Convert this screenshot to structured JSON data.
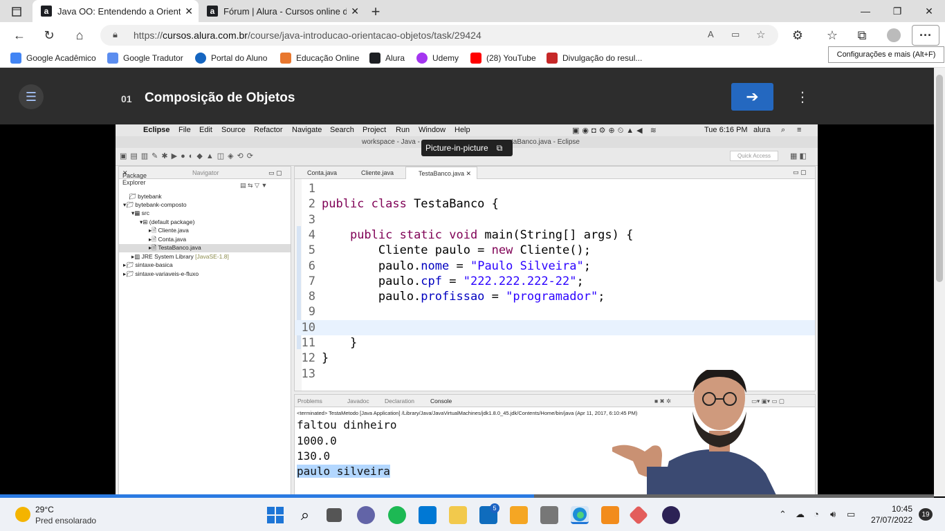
{
  "browser": {
    "tabs": [
      {
        "favicon": "a",
        "title": "Java OO: Entendendo a Orientaç",
        "active": true
      },
      {
        "favicon": "a",
        "title": "Fórum | Alura - Cursos online de",
        "active": false
      }
    ],
    "new_tab": "+",
    "url_scheme": "https://",
    "url_host": "cursos.alura.com.br",
    "url_path": "/course/java-introducao-orientacao-objetos/task/29424",
    "bookmarks": [
      {
        "label": "Google Acadêmico",
        "color": "#4285f4"
      },
      {
        "label": "Google Tradutor",
        "color": "#5b8def"
      },
      {
        "label": "Portal do Aluno",
        "color": "#1565c0"
      },
      {
        "label": "Educação Online",
        "color": "#e8772e"
      },
      {
        "label": "Alura",
        "color": "#1d1f23"
      },
      {
        "label": "Udemy",
        "color": "#a435f0"
      },
      {
        "label": "(28) YouTube",
        "color": "#ff0000"
      },
      {
        "label": "Divulgação do resul...",
        "color": "#c62828"
      }
    ],
    "tooltip": "Configurações e mais (Alt+F)"
  },
  "lesson": {
    "number": "01",
    "title": "Composição de Objetos"
  },
  "mac": {
    "menu": [
      "Eclipse",
      "File",
      "Edit",
      "Source",
      "Refactor",
      "Navigate",
      "Search",
      "Project",
      "Run",
      "Window",
      "Help"
    ],
    "time": "Tue 6:16 PM",
    "user": "alura",
    "window_title_left": "workspace - Java -",
    "window_title_right": "taBanco.java - Eclipse",
    "pip_label": "Picture-in-picture",
    "quick_access": "Quick Access"
  },
  "package_explorer": {
    "tab_label": "Package Explorer",
    "navigator_label": "Navigator",
    "items": [
      "bytebank",
      "bytebank-composto",
      "src",
      "(default package)",
      "Cliente.java",
      "Conta.java",
      "TestaBanco.java",
      "JRE System Library",
      "sintaxe-basica",
      "sintaxe-variaveis-e-fluxo"
    ],
    "jre_version": "[JavaSE-1.8]"
  },
  "editor": {
    "tabs": [
      "Conta.java",
      "Cliente.java",
      "TestaBanco.java"
    ],
    "lines": [
      {
        "n": "1",
        "segs": []
      },
      {
        "n": "2",
        "segs": [
          {
            "c": "kw",
            "t": "public class"
          },
          {
            "c": "",
            "t": " TestaBanco {"
          }
        ]
      },
      {
        "n": "3",
        "segs": []
      },
      {
        "n": "4",
        "segs": [
          {
            "c": "",
            "t": "    "
          },
          {
            "c": "kw",
            "t": "public static void"
          },
          {
            "c": "",
            "t": " main(String[] args) {"
          }
        ]
      },
      {
        "n": "5",
        "segs": [
          {
            "c": "",
            "t": "        Cliente paulo = "
          },
          {
            "c": "kw",
            "t": "new"
          },
          {
            "c": "",
            "t": " Cliente();"
          }
        ]
      },
      {
        "n": "6",
        "segs": [
          {
            "c": "",
            "t": "        paulo."
          },
          {
            "c": "fld",
            "t": "nome"
          },
          {
            "c": "",
            "t": " = "
          },
          {
            "c": "str",
            "t": "\"Paulo Silveira\""
          },
          {
            "c": "",
            "t": ";"
          }
        ]
      },
      {
        "n": "7",
        "segs": [
          {
            "c": "",
            "t": "        paulo."
          },
          {
            "c": "fld",
            "t": "cpf"
          },
          {
            "c": "",
            "t": " = "
          },
          {
            "c": "str",
            "t": "\"222.222.222-22\""
          },
          {
            "c": "",
            "t": ";"
          }
        ]
      },
      {
        "n": "8",
        "segs": [
          {
            "c": "",
            "t": "        paulo."
          },
          {
            "c": "fld",
            "t": "profissao"
          },
          {
            "c": "",
            "t": " = "
          },
          {
            "c": "str",
            "t": "\"programador\""
          },
          {
            "c": "",
            "t": ";"
          }
        ]
      },
      {
        "n": "9",
        "segs": []
      },
      {
        "n": "10",
        "segs": []
      },
      {
        "n": "11",
        "segs": [
          {
            "c": "",
            "t": "    }"
          }
        ]
      },
      {
        "n": "12",
        "segs": [
          {
            "c": "",
            "t": "}"
          }
        ]
      },
      {
        "n": "13",
        "segs": []
      }
    ],
    "current_line": "10"
  },
  "console": {
    "tabs": [
      "Problems",
      "Javadoc",
      "Declaration",
      "Console"
    ],
    "terminated": "<terminated> TestaMetodo [Java Application] /Library/Java/JavaVirtualMachines/jdk1.8.0_45.jdk/Contents/Home/bin/java (Apr 11, 2017, 6:10:45 PM)",
    "output": [
      "faltou dinheiro",
      "1000.0",
      "130.0",
      "paulo silveira"
    ]
  },
  "video": {
    "progress": 0.572
  },
  "taskbar": {
    "temperature": "29°C",
    "condition": "Pred ensolarado",
    "mail_badge": "5",
    "time": "10:45",
    "date": "27/07/2022",
    "notifications": "19"
  }
}
